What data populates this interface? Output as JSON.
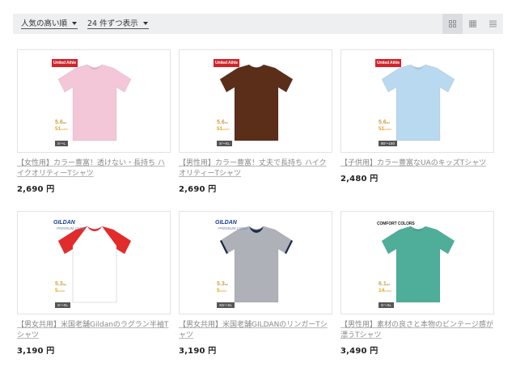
{
  "toolbar": {
    "sort_label": "人気の高い順",
    "perpage_label": "24 件ずつ表示"
  },
  "products": [
    {
      "name": "【女性用】カラー豊富！透けない・長持ち ハイクオリティーTシャツ",
      "price": "2,690 円",
      "brand": "United Athle",
      "oz": "5.6",
      "colors": "51",
      "sizes": "S～L",
      "shirt_color": "#f3c6d8",
      "trim_color": "#f3c6d8",
      "style": "tee"
    },
    {
      "name": "【男性用】カラー豊富！丈夫で長持ち ハイクオリティーTシャツ",
      "price": "2,690 円",
      "brand": "United Athle",
      "oz": "5.6",
      "colors": "51",
      "sizes": "S～XL",
      "shirt_color": "#5a2e19",
      "trim_color": "#5a2e19",
      "style": "tee"
    },
    {
      "name": "【子供用】カラー豊富なUAのキッズTシャツ",
      "price": "2,480 円",
      "brand": "United Athle",
      "oz": "5.6",
      "colors": "51",
      "sizes": "90～160",
      "shirt_color": "#b9d9f1",
      "trim_color": "#b9d9f1",
      "style": "tee"
    },
    {
      "name": "【男女共用】米国老舗Gildanのラグラン半袖Tシャツ",
      "price": "3,190 円",
      "brand": "GILDAN",
      "brand_sub": "PREMIUM Cotton",
      "oz": "5.3",
      "colors": "5",
      "sizes": "S～XL",
      "shirt_color": "#ffffff",
      "trim_color": "#e22b2b",
      "style": "raglan"
    },
    {
      "name": "【男女共用】米国老舗GILDANのリンガーTシャツ",
      "price": "3,190 円",
      "brand": "GILDAN",
      "brand_sub": "PREMIUM Cotton",
      "oz": "5.3",
      "colors": "5",
      "sizes": "XS～XL",
      "shirt_color": "#aeb2b8",
      "trim_color": "#1e2a4a",
      "style": "ringer"
    },
    {
      "name": "【男性用】素材の良さと本物のビンテージ感が漂うTシャツ",
      "price": "3,490 円",
      "brand": "COMFORT COLORS",
      "oz": "6.1",
      "colors": "14",
      "sizes": "S～XL",
      "shirt_color": "#4fae9a",
      "trim_color": "#4fae9a",
      "style": "tee"
    }
  ],
  "spec_units": {
    "oz_unit": "oz",
    "color_unit": "color"
  },
  "icons": [
    "caret-down-icon",
    "grid-large-view-icon",
    "grid-small-view-icon",
    "list-view-icon"
  ]
}
